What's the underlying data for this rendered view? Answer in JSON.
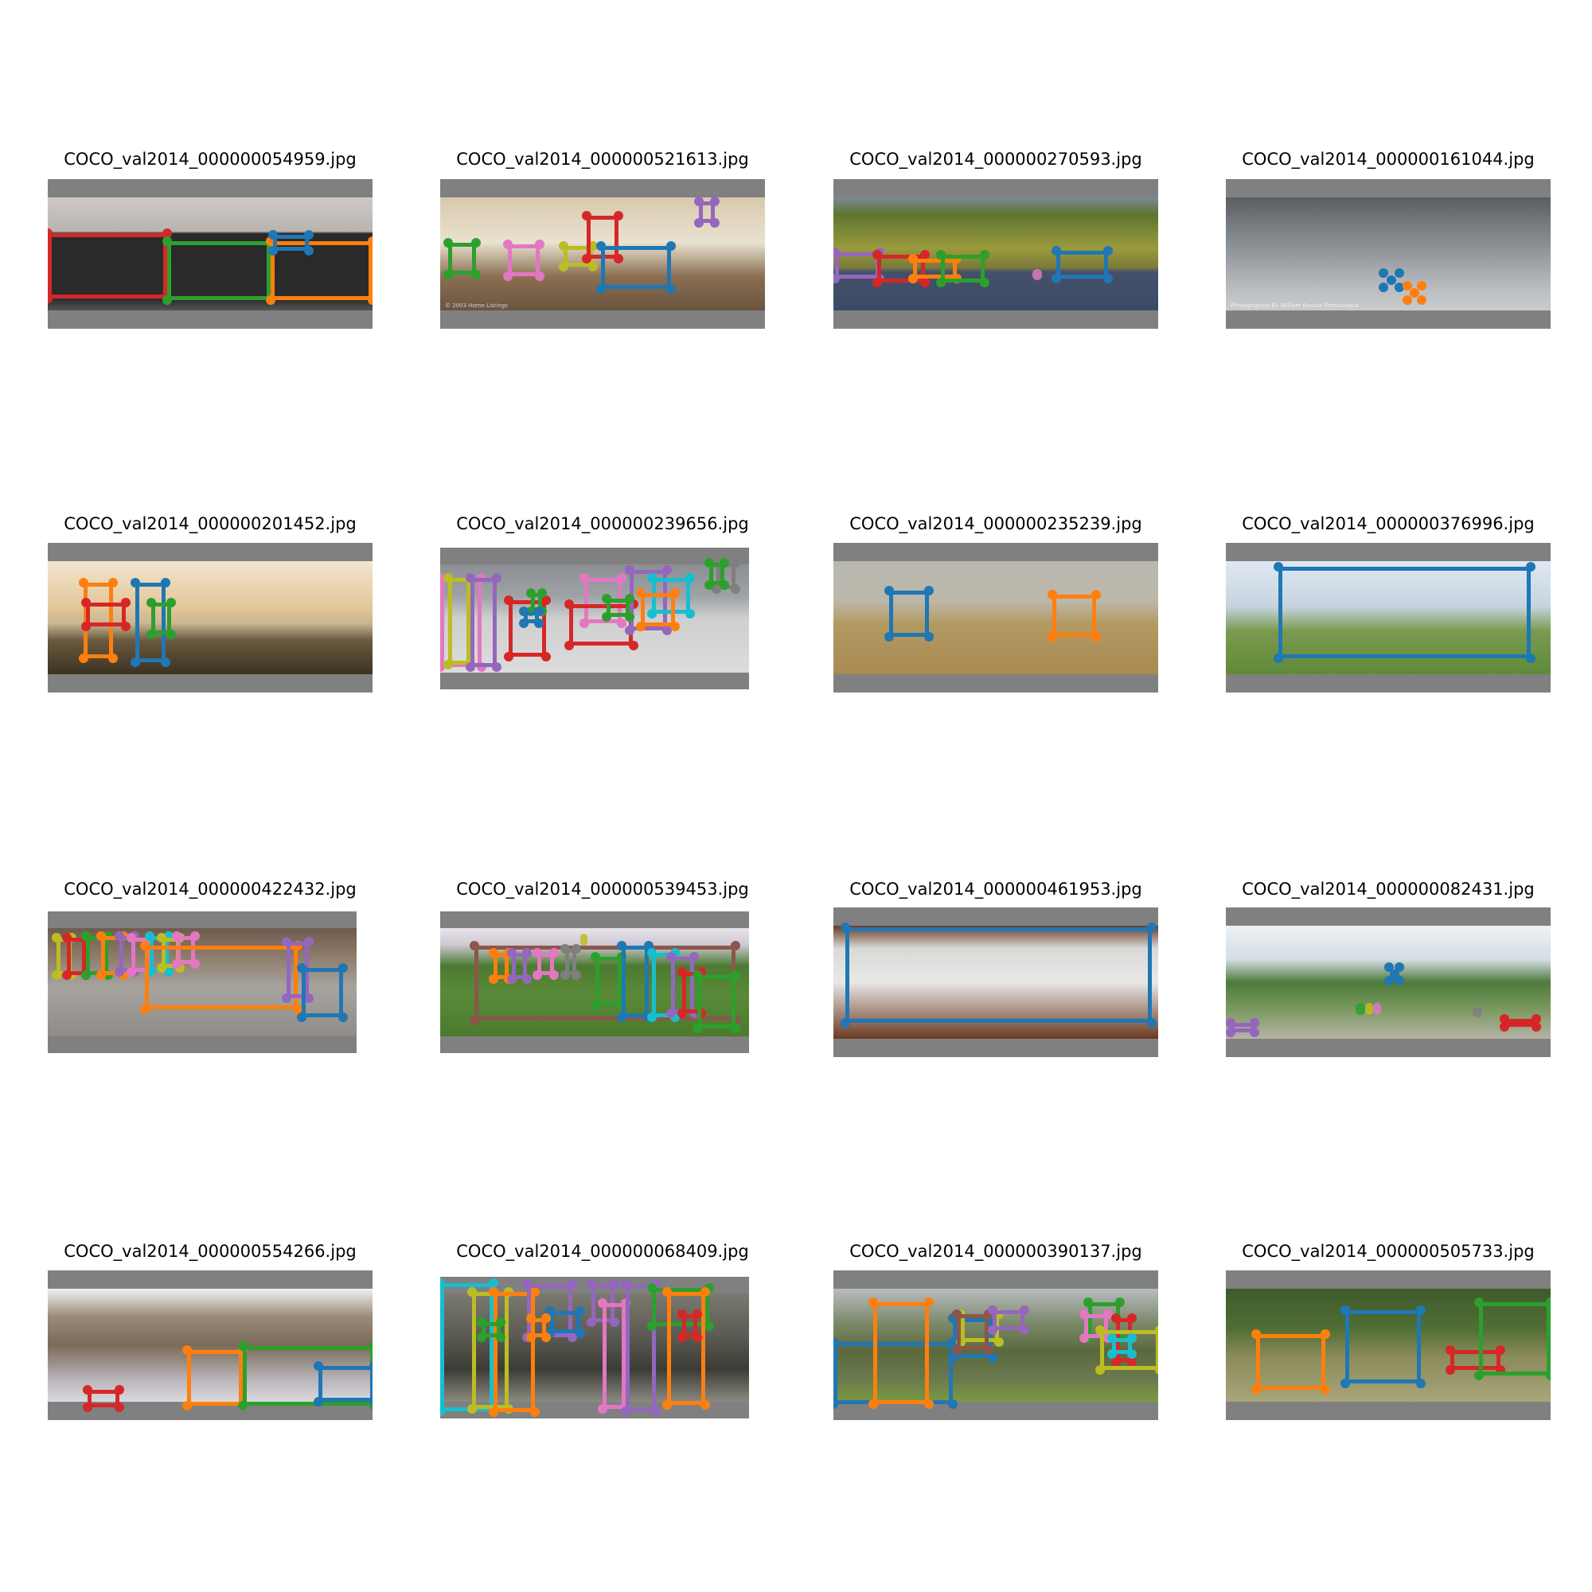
{
  "figure": {
    "panels": [
      {
        "title": "COCO_val2014_000000054959.jpg"
      },
      {
        "title": "COCO_val2014_000000521613.jpg",
        "watermark": "© 2003 Home Listings"
      },
      {
        "title": "COCO_val2014_000000270593.jpg"
      },
      {
        "title": "COCO_val2014_000000161044.jpg",
        "watermark": "Photographed By William Burdus Photos/Aqua"
      },
      {
        "title": "COCO_val2014_000000201452.jpg"
      },
      {
        "title": "COCO_val2014_000000239656.jpg"
      },
      {
        "title": "COCO_val2014_000000235239.jpg"
      },
      {
        "title": "COCO_val2014_000000376996.jpg"
      },
      {
        "title": "COCO_val2014_000000422432.jpg"
      },
      {
        "title": "COCO_val2014_000000539453.jpg"
      },
      {
        "title": "COCO_val2014_000000461953.jpg"
      },
      {
        "title": "COCO_val2014_000000082431.jpg"
      },
      {
        "title": "COCO_val2014_000000554266.jpg"
      },
      {
        "title": "COCO_val2014_000000068409.jpg"
      },
      {
        "title": "COCO_val2014_000000390137.jpg"
      },
      {
        "title": "COCO_val2014_000000505733.jpg"
      }
    ],
    "box_colors": [
      "#1f77b4",
      "#ff7f0e",
      "#2ca02c",
      "#d62728",
      "#9467bd",
      "#8c564b",
      "#e377c2",
      "#7f7f7f",
      "#bcbd22",
      "#17becf"
    ],
    "frame_color": "#808080"
  }
}
